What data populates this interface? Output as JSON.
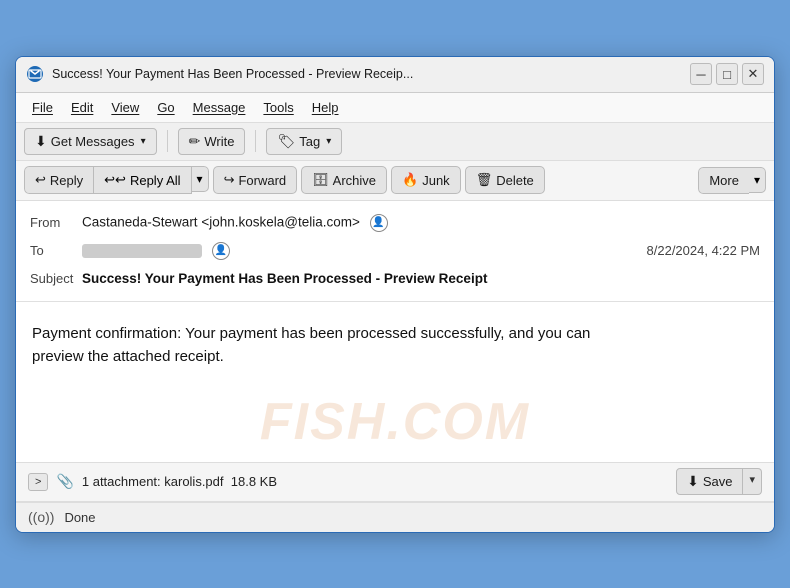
{
  "window": {
    "title": "Success! Your Payment Has Been Processed - Preview Receip...",
    "icon": "📧"
  },
  "titlebar": {
    "minimize_label": "─",
    "maximize_label": "□",
    "close_label": "✕"
  },
  "menubar": {
    "items": [
      {
        "id": "file",
        "label": "File"
      },
      {
        "id": "edit",
        "label": "Edit"
      },
      {
        "id": "view",
        "label": "View"
      },
      {
        "id": "go",
        "label": "Go"
      },
      {
        "id": "message",
        "label": "Message"
      },
      {
        "id": "tools",
        "label": "Tools"
      },
      {
        "id": "help",
        "label": "Help"
      }
    ]
  },
  "toolbar": {
    "get_messages_label": "Get Messages",
    "write_label": "Write",
    "tag_label": "Tag"
  },
  "actions": {
    "reply_label": "Reply",
    "reply_all_label": "Reply All",
    "forward_label": "Forward",
    "archive_label": "Archive",
    "junk_label": "Junk",
    "delete_label": "Delete",
    "more_label": "More"
  },
  "email": {
    "from_label": "From",
    "from_name": "Castaneda-Stewart",
    "from_email": "<john.koskela@telia.com>",
    "to_label": "To",
    "to_value": "████████████████",
    "date": "8/22/2024, 4:22 PM",
    "subject_label": "Subject",
    "subject": "Success! Your Payment Has Been Processed - Preview Receipt",
    "body": "Payment confirmation: Your payment has been processed successfully, and you can preview the attached receipt."
  },
  "attachment": {
    "expand_label": ">",
    "count_label": "1 attachment: karolis.pdf",
    "size_label": "18.8 KB",
    "save_label": "Save",
    "paperclip": "📎"
  },
  "statusbar": {
    "icon": "((o))",
    "text": "Done"
  },
  "watermark": {
    "text": "FISH.COM"
  }
}
